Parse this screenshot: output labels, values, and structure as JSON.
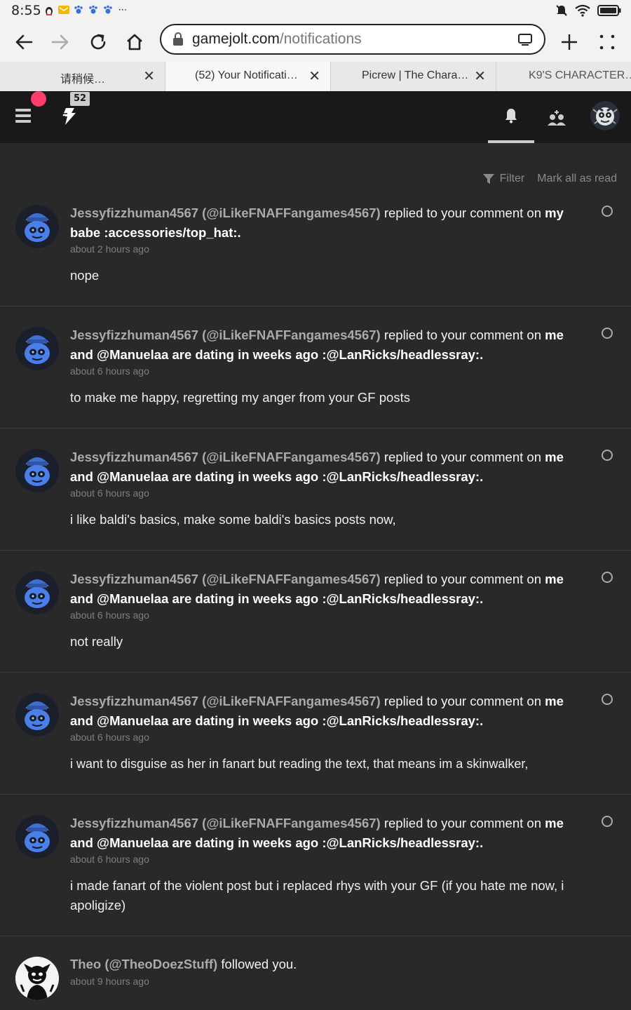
{
  "status": {
    "time": "8:55",
    "app_icons": [
      "penguin-icon",
      "mail-icon",
      "paw-icon",
      "paw-icon",
      "paw-icon",
      "more-icon"
    ]
  },
  "browser": {
    "url_domain": "gamejolt.com",
    "url_path": "/notifications",
    "tabs": [
      {
        "title": "请稍候…"
      },
      {
        "title": "(52) Your Notificati…"
      },
      {
        "title": "Picrew | The Chara…"
      },
      {
        "title": "K9'S CHARACTER…"
      }
    ]
  },
  "header": {
    "notification_count": "52"
  },
  "actions": {
    "filter_label": "Filter",
    "mark_all_label": "Mark all as read"
  },
  "notifications": [
    {
      "user": "Jessyfizzhuman4567 (@iLikeFNAFFangames4567)",
      "action": "replied to your comment on",
      "target": "my babe :accessories/top_hat:.",
      "time": "about 2 hours ago",
      "body": "nope"
    },
    {
      "user": "Jessyfizzhuman4567 (@iLikeFNAFFangames4567)",
      "action": "replied to your comment on",
      "target": "me and @Manuelaa are dating in weeks ago :@LanRicks/headlessray:.",
      "time": "about 6 hours ago",
      "body": "to make me happy, regretting my anger from your GF posts"
    },
    {
      "user": "Jessyfizzhuman4567 (@iLikeFNAFFangames4567)",
      "action": "replied to your comment on",
      "target": "me and @Manuelaa are dating in weeks ago :@LanRicks/headlessray:.",
      "time": "about 6 hours ago",
      "body": "i like baldi's basics, make some baldi's basics posts now,"
    },
    {
      "user": "Jessyfizzhuman4567 (@iLikeFNAFFangames4567)",
      "action": "replied to your comment on",
      "target": "me and @Manuelaa are dating in weeks ago :@LanRicks/headlessray:.",
      "time": "about 6 hours ago",
      "body": "not really"
    },
    {
      "user": "Jessyfizzhuman4567 (@iLikeFNAFFangames4567)",
      "action": "replied to your comment on",
      "target": "me and @Manuelaa are dating in weeks ago :@LanRicks/headlessray:.",
      "time": "about 6 hours ago",
      "body": "i want to disguise as her in fanart but reading the text, that means im a skinwalker,"
    },
    {
      "user": "Jessyfizzhuman4567 (@iLikeFNAFFangames4567)",
      "action": "replied to your comment on",
      "target": "me and @Manuelaa are dating in weeks ago :@LanRicks/headlessray:.",
      "time": "about 6 hours ago",
      "body": "i made fanart of the violent post but i replaced rhys with your GF (if you hate me now, i apoligize)"
    },
    {
      "user": "Theo (@TheoDoezStuff)",
      "action": "followed you.",
      "target": "",
      "time": "about 9 hours ago",
      "body": ""
    }
  ],
  "colors": {
    "page_bg": "#292929",
    "header_bg": "#191919",
    "accent_pink": "#ff3d6c"
  }
}
